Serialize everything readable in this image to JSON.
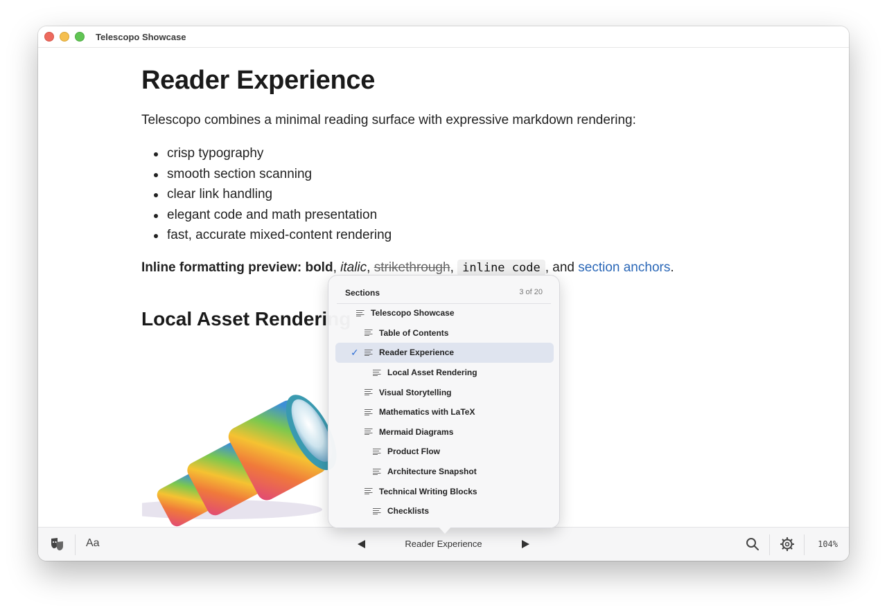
{
  "window": {
    "title": "Telescopo Showcase"
  },
  "doc": {
    "h1": "Reader Experience",
    "intro": "Telescopo combines a minimal reading surface with expressive markdown rendering:",
    "bullets": [
      "crisp typography",
      "smooth section scanning",
      "clear link handling",
      "elegant code and math presentation",
      "fast, accurate mixed-content rendering"
    ],
    "inline": {
      "prefix": "Inline formatting preview: bold",
      "comma1": ", ",
      "italic": "italic",
      "comma2": ", ",
      "strike": "strikethrough",
      "comma3": ", ",
      "code": "inline code",
      "and": ", and ",
      "link": "section anchors",
      "end": "."
    },
    "h2": "Local Asset Rendering"
  },
  "popover": {
    "header": "Sections",
    "count": "3 of 20",
    "items": [
      {
        "label": "Telescopo Showcase",
        "level": 1
      },
      {
        "label": "Table of Contents",
        "level": 2
      },
      {
        "label": "Reader Experience",
        "level": 2,
        "active": true
      },
      {
        "label": "Local Asset Rendering",
        "level": 3
      },
      {
        "label": "Visual Storytelling",
        "level": 2
      },
      {
        "label": "Mathematics with LaTeX",
        "level": 2
      },
      {
        "label": "Mermaid Diagrams",
        "level": 2
      },
      {
        "label": "Product Flow",
        "level": 3
      },
      {
        "label": "Architecture Snapshot",
        "level": 3
      },
      {
        "label": "Technical Writing Blocks",
        "level": 2
      },
      {
        "label": "Checklists",
        "level": 3
      }
    ]
  },
  "toolbar": {
    "font_label": "Aa",
    "section": "Reader Experience",
    "zoom": "104%",
    "icons": [
      "theater-masks-icon",
      "prev-section-icon",
      "next-section-icon",
      "search-icon",
      "settings-gear-icon"
    ]
  },
  "colors": {
    "accent": "#2f6fd6",
    "link": "#2a67b7",
    "active_row": "#dfe4ef"
  }
}
